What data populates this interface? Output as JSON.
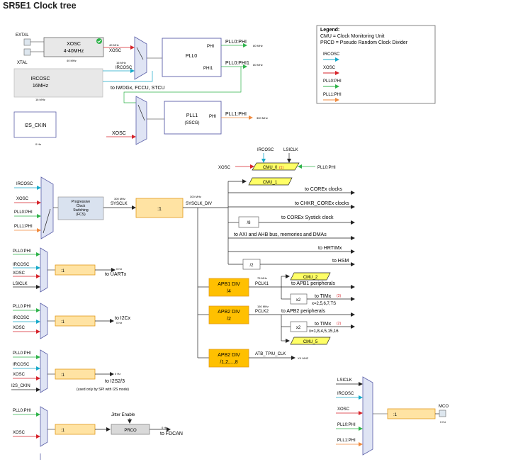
{
  "title": "SR5E1 Clock tree",
  "legend": {
    "heading": "Legend:",
    "cmu": "CMU = Clock Monitoring Unit",
    "prcd": "PRCD = Pseudo Random Clock Divider",
    "items": [
      {
        "label": "IRCOSC",
        "color": "#17a9c9"
      },
      {
        "label": "XOSC",
        "color": "#d6232a"
      },
      {
        "label": "PLL0:PHI",
        "color": "#2fb34a"
      },
      {
        "label": "PLL1:PHI",
        "color": "#f08a3e"
      }
    ]
  },
  "colors": {
    "ircosc": "#17a9c9",
    "xosc": "#d6232a",
    "pll0": "#2fb34a",
    "pll1": "#f08a3e",
    "mux_fill": "#dfe4f4",
    "mux_stroke": "#5b5fa8",
    "divider_fill": "#ffe3a3",
    "divider_stroke": "#e29a1c",
    "apb_fill": "#ffc000",
    "cmu_fill": "#ffff66",
    "gray_fill": "#e8e8e8",
    "fcs_fill": "#d9e2ef"
  },
  "icons": [
    "check-icon",
    "arrow-icon",
    "mux-icon"
  ],
  "osc": {
    "extal": "EXTAL",
    "xtal": "XTAL",
    "xosc_name": "XOSC",
    "xosc_range": "4-40MHz",
    "xosc_freq": "40 MHz",
    "xosc_out_freq": "40 MHz",
    "xosc_out": "XOSC",
    "ircosc_name": "IRCOSC",
    "ircosc_range": "16MHz",
    "ircosc_freq": "16 MHz",
    "ircosc_mux_freq": "16 MHz",
    "ircosc_out": "IRCOSC",
    "to_iwdg": "to IWDGx, FCCU, STCU",
    "i2s_name": "I2S_CKIN",
    "i2s_freq": "0 Hz"
  },
  "pll0": {
    "name": "PLL0",
    "phi": "PHI",
    "phi1": "PHI1",
    "out_phi": "PLL0:PHI",
    "out_phi_freq": "80 MHz",
    "out_phi1": "PLL0:PHI1",
    "out_phi1_freq": "80 MHz"
  },
  "pll1": {
    "name": "PLL1",
    "sub": "(SSCG)",
    "phi": "PHI",
    "xosc_in": "XOSC",
    "out": "PLL1:PHI",
    "out_freq": "300 MHz"
  },
  "cmu0": {
    "label": "CMU_0",
    "sup": "(1)",
    "ircosc": "IRCOSC",
    "lsiclk": "LSICLK",
    "xosc": "XOSC",
    "pll0": "PLL0:PHI"
  },
  "sys": {
    "inputs": [
      "IRCOSC",
      "XOSC",
      "PLL0:PHI",
      "PLL1:PHI"
    ],
    "fcs": [
      "Progressive",
      "Clock",
      "Switching",
      "(FCS)"
    ],
    "sysclk_freq": "300 MHz",
    "sysclk": "SYSCLK",
    "div": ":1",
    "div_freq": "300 MHz",
    "div_out": "SYSCLK_DIV",
    "cmu1": "CMU_1",
    "corex": "to COREx clocks",
    "chkr": "to CHKR_COREx clocks",
    "systick_div": "/8",
    "systick": "to COREx Systick clock",
    "axi": "to AXI and AHB bus, memories and DMAs",
    "hrtim": "to HRTIMx",
    "hsm_div": "/2",
    "hsm": "to HSM"
  },
  "apb1": {
    "label": "APB1 DIV",
    "div": "/4",
    "freq": "75 MHz",
    "clk": "PCLK1",
    "cmu": "CMU_2",
    "periph": "to APB1 peripherals",
    "x2": "x2",
    "tim": "to TIMx",
    "tim_sup": "(3)",
    "tim_list": "x=2,5,6,7,TS"
  },
  "apb2": {
    "label": "APB2 DIV",
    "div": "/2",
    "freq": "150 MHz",
    "clk": "PCLK2",
    "periph": "to APB2 peripherals",
    "x2": "x2",
    "tim": "to TIMx",
    "tim_sup": "(2)",
    "tim_list": "x=1,8,4,5,15,16",
    "cmu": "CMU_5"
  },
  "apb3": {
    "label": "APB2 DIV",
    "div": "/1,2,...,8",
    "clk": "ATB_TPIU_CLK",
    "freq": "XX MHZ"
  },
  "uart": {
    "inputs": [
      "PLL0:PHI",
      "IRCOSC",
      "XOSC",
      "LSICLK"
    ],
    "div": ":1",
    "freq": "0 Hz",
    "out": "to UARTx"
  },
  "i2c": {
    "inputs": [
      "PLL0:PHI",
      "IRCOSC",
      "XOSC"
    ],
    "div": ":1",
    "out": "to I2Cx",
    "freq": "0 Hz"
  },
  "i2s": {
    "inputs": [
      "PLL0:PHI",
      "IRCOSC",
      "XOSC",
      "I2S_CKIN"
    ],
    "div": ":1",
    "freq": "0 Hz",
    "out": "to I2S2/3",
    "note": "(used only by SPI with I2S mode)"
  },
  "fdcan": {
    "inputs": [
      "PLL0:PHI",
      "XOSC"
    ],
    "div": ":1",
    "jitter": "Jitter Enable",
    "prco": "PRCO",
    "freq": "0 Hz",
    "out": "to FDCAN"
  },
  "mco": {
    "inputs": [
      "LSICLK",
      "IRCOSC",
      "XOSC",
      "PLL0:PHI",
      "PLL1:PHI"
    ],
    "div": ":1",
    "label": "MCO",
    "freq": "0 Hz"
  }
}
